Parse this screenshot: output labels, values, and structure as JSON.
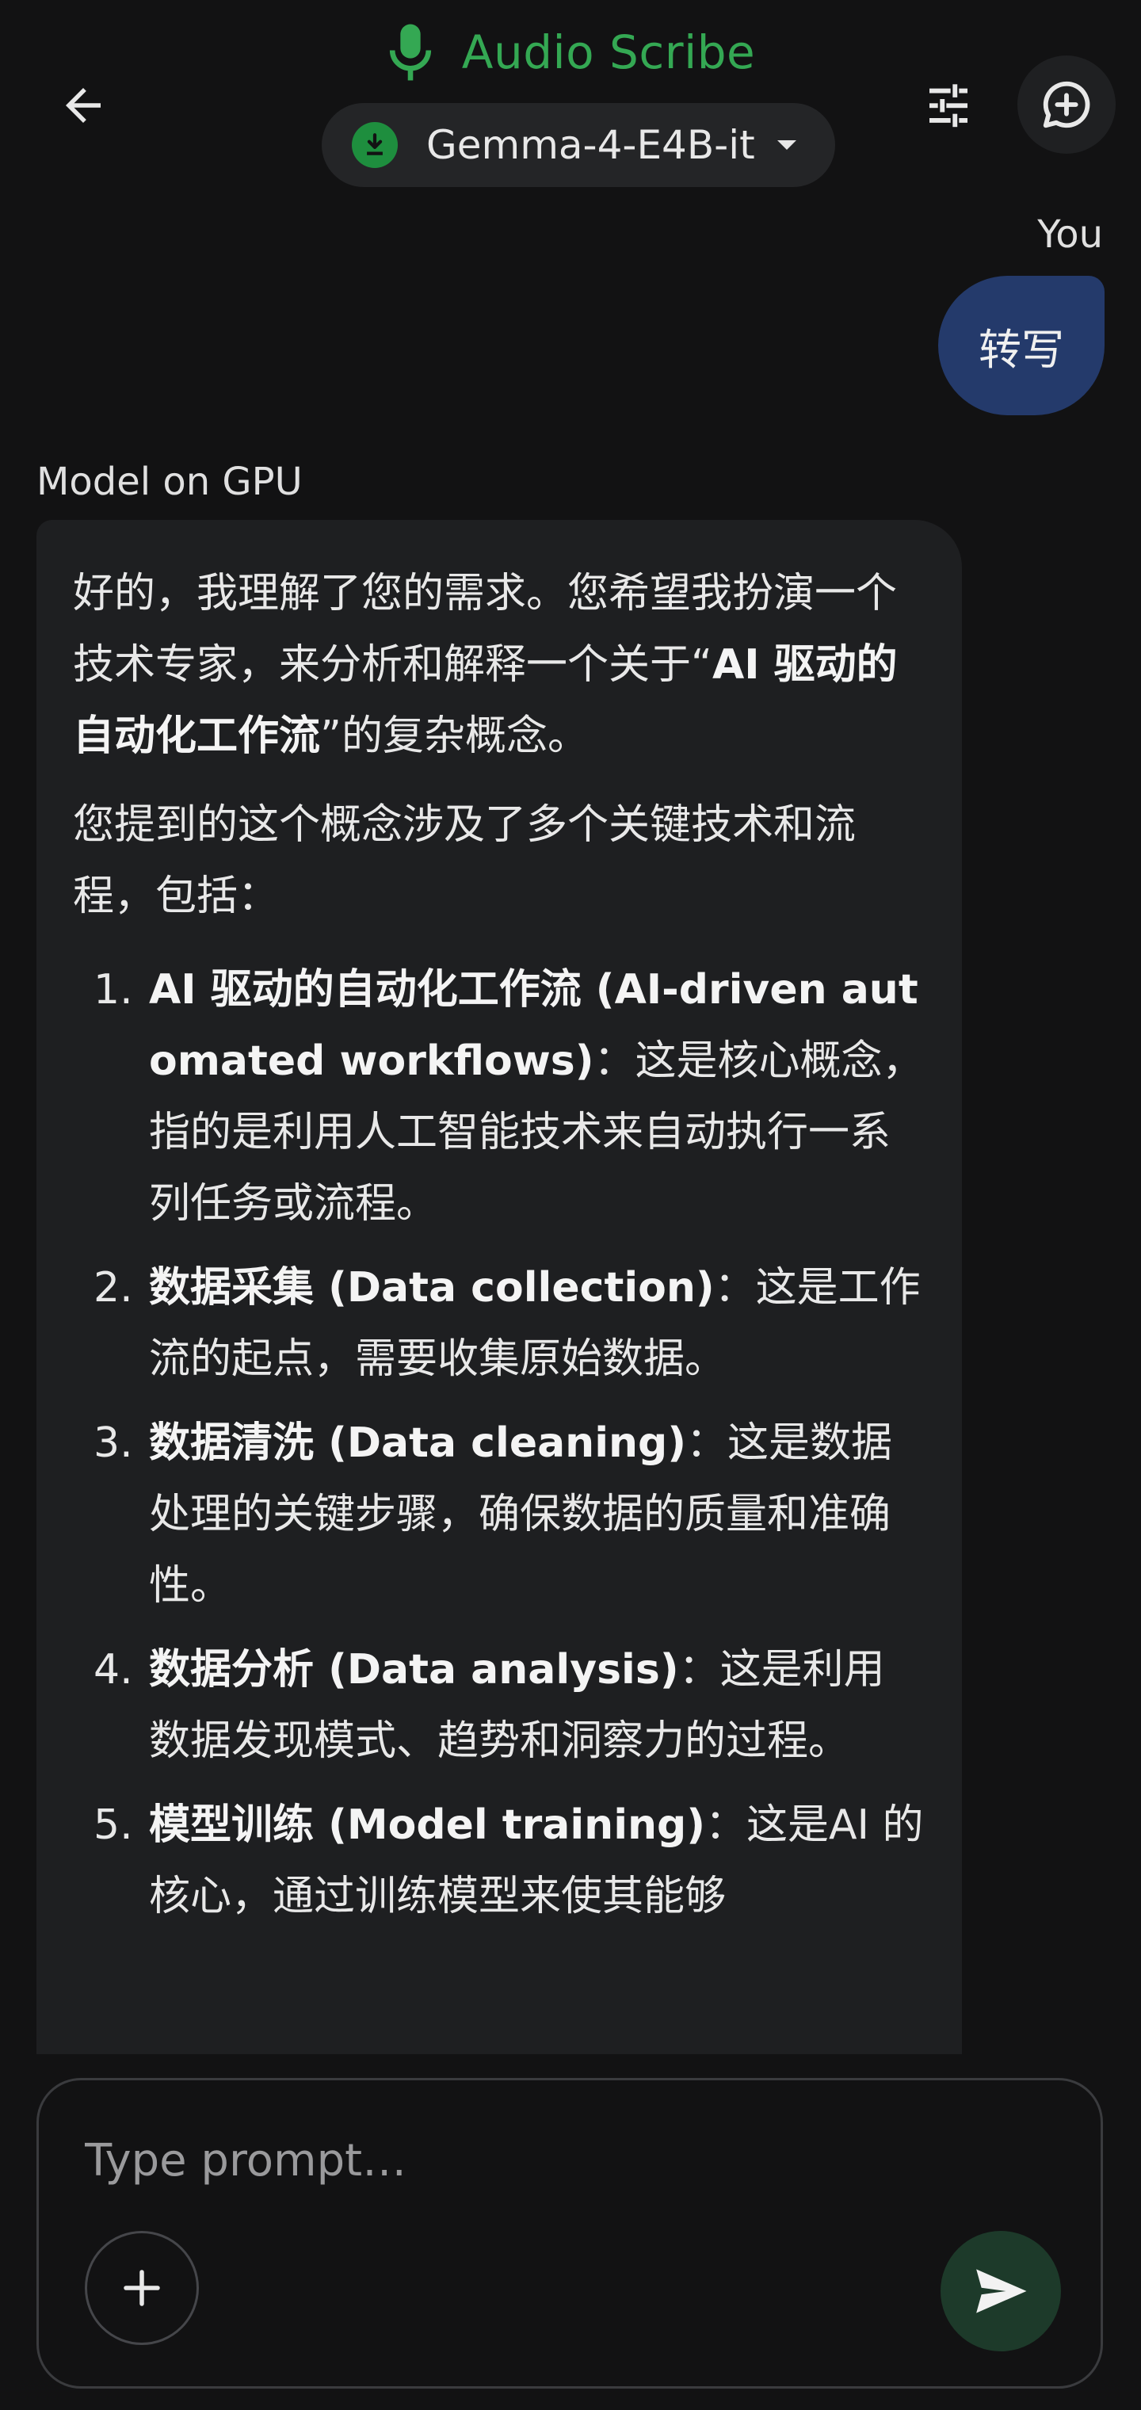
{
  "header": {
    "app_title": "Audio Scribe",
    "model_selector": "Gemma-4-E4B-it",
    "accent_color": "#34a853"
  },
  "icons": {
    "back": "arrow-left-icon",
    "mic": "microphone-icon",
    "download": "download-icon",
    "dropdown": "caret-down-icon",
    "tune": "sliders-icon",
    "new_chat": "chat-add-icon",
    "add": "plus-icon",
    "send": "send-icon"
  },
  "chat": {
    "user_label": "You",
    "user_message": "转写",
    "model_label": "Model on GPU",
    "model_response": {
      "para1_pre": "好的，我理解了您的需求。您希望我扮演一个技术专家，来分析和解释一个关于“",
      "para1_bold": "AI 驱动的自动化工作流",
      "para1_post": "”的复杂概念。",
      "para2": "您提到的这个概念涉及了多个关键技术和流程，包括：",
      "items": [
        {
          "num": "1.",
          "bold": "AI 驱动的自动化工作流 (AI-driven automated workflows)",
          "text": "：这是核心概念，指的是利用人工智能技术来自动执行一系列任务或流程。"
        },
        {
          "num": "2.",
          "bold": "数据采集 (Data collection)",
          "text": "：这是工作流的起点，需要收集原始数据。"
        },
        {
          "num": "3.",
          "bold": "数据清洗 (Data cleaning)",
          "text": "：这是数据处理的关键步骤，确保数据的质量和准确性。"
        },
        {
          "num": "4.",
          "bold": "数据分析 (Data analysis)",
          "text": "：这是利用数据发现模式、趋势和洞察力的过程。"
        },
        {
          "num": "5.",
          "bold": "模型训练 (Model training)",
          "text": "：这是AI 的核心，通过训练模型来使其能够"
        }
      ]
    }
  },
  "composer": {
    "placeholder": "Type prompt…"
  }
}
